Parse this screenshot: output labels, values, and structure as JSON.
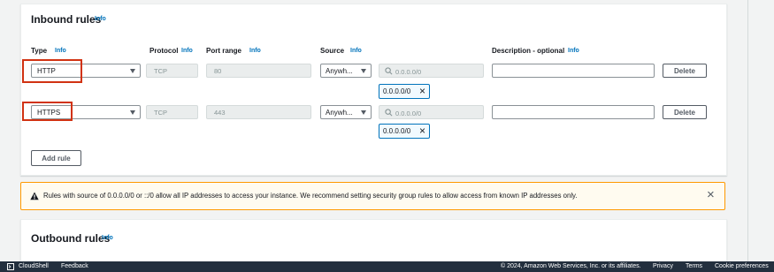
{
  "inbound": {
    "title": "Inbound rules",
    "info": "Info",
    "headers": {
      "type": "Type",
      "protocol": "Protocol",
      "port_range": "Port range",
      "source": "Source",
      "description": "Description - optional"
    },
    "rules": [
      {
        "type": "HTTP",
        "protocol": "TCP",
        "port": "80",
        "source_type": "Anywh...",
        "cidr_placeholder": "0.0.0.0/0",
        "token": "0.0.0.0/0",
        "delete": "Delete"
      },
      {
        "type": "HTTPS",
        "protocol": "TCP",
        "port": "443",
        "source_type": "Anywh...",
        "cidr_placeholder": "0.0.0.0/0",
        "token": "0.0.0.0/0",
        "delete": "Delete"
      }
    ],
    "add_rule": "Add rule"
  },
  "warning": {
    "text": "Rules with source of 0.0.0.0/0 or ::/0 allow all IP addresses to access your instance. We recommend setting security group rules to allow access from known IP addresses only."
  },
  "outbound": {
    "title": "Outbound rules",
    "info": "Info"
  },
  "footer": {
    "cloudshell": "CloudShell",
    "feedback": "Feedback",
    "copyright": "© 2024, Amazon Web Services, Inc. or its affiliates.",
    "privacy": "Privacy",
    "terms": "Terms",
    "cookie": "Cookie preferences"
  },
  "colors": {
    "accent": "#0073bb",
    "warning_bg": "#fffbf0",
    "warning_border": "#ff9900",
    "highlight": "#d13212",
    "footer_bg": "#232f3e"
  }
}
